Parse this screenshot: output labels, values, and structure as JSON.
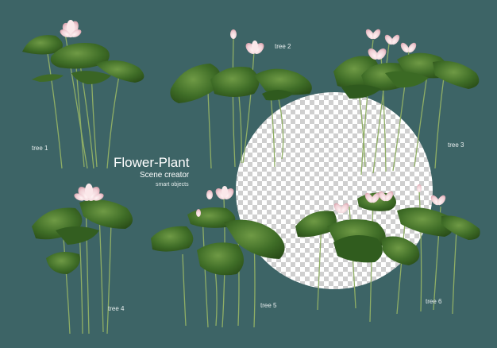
{
  "poster": {
    "title": "Flower-Plant",
    "subtitle": "Scene creator",
    "caption": "smart objects"
  },
  "trees": [
    {
      "label": "tree 1"
    },
    {
      "label": "tree 2"
    },
    {
      "label": "tree 3"
    },
    {
      "label": "tree 4"
    },
    {
      "label": "tree 5"
    },
    {
      "label": "tree 6"
    }
  ],
  "colors": {
    "background": "#3d6466",
    "leaf_dark": "#2f5a1f",
    "leaf_light": "#5c8a3a",
    "stem": "#8aa860",
    "petal": "#f2d8dc",
    "checker_light": "#ffffff",
    "checker_dark": "#cccccc"
  }
}
